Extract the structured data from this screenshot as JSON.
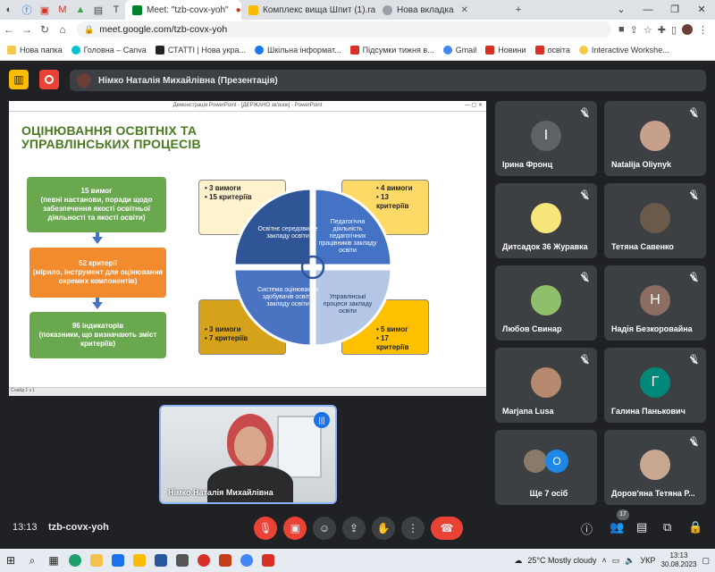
{
  "browser": {
    "tabs": [
      {
        "label": "Meet: \"tzb-covx-yoh\"",
        "active": true
      },
      {
        "label": "Комплекс вища Шпит (1).rar - G",
        "active": false
      },
      {
        "label": "Нова вкладка",
        "active": false
      }
    ],
    "url": "meet.google.com/tzb-covx-yoh",
    "bookmarks": [
      "Нова папка",
      "Головна – Canva",
      "СТАТТІ | Нова укра...",
      "Шкільна інформат...",
      "Підсумки тижня в...",
      "Gmail",
      "Новини",
      "освіта",
      "Interactive Workshe..."
    ]
  },
  "meet": {
    "presenting_label": "Німко Наталія Михайлівна (Презентація)",
    "time": "13:13",
    "code": "tzb-covx-yoh",
    "participants_badge": "17"
  },
  "slide": {
    "window_title": "Демонстрація PowerPoint - [ДЕРЖАНО зв'язок] - PowerPoint",
    "title_line1": "ОЦІНЮВАННЯ ОСВІТНІХ ТА",
    "title_line2": "УПРАВЛІНСЬКИХ ПРОЦЕСІВ",
    "green1_line1": "15 вимог",
    "green1_line2": "(певні настанови, поради щодо забезпечення якості освітньої діяльності та якості освіти)",
    "orange_line1": "52 критерії",
    "orange_line2": "(мірило, інструмент для оцінювання окремих компонентів)",
    "green2_line1": "96 індикаторів",
    "green2_line2": "(показники, що визначають зміст критеріїв)",
    "q1": "Освітнє середовище закладу освіти",
    "q2": "Педагогічна діяльність педагогічних працівників закладу освіти",
    "q3": "Система оцінювання здобувачів освіти закладу освіти",
    "q4": "Управлінські процеси закладу освіти",
    "box_tl": [
      "3 вимоги",
      "15 критеріїв"
    ],
    "box_tr": [
      "4 вимоги",
      "13 критеріїв"
    ],
    "box_bl": [
      "3 вимоги",
      "7 критеріїв"
    ],
    "box_br": [
      "5 вимог",
      "17 критеріїв"
    ],
    "status": "Слайд 1 з 1"
  },
  "participants": [
    {
      "name": "Ірина Фронц",
      "initial": "І",
      "color": "#5f6368"
    },
    {
      "name": "Natalija Oliynyk",
      "initial": "",
      "color": "#c7a08a"
    },
    {
      "name": "Дитсадок 36 Журавка",
      "initial": "",
      "color": "#f7e57a"
    },
    {
      "name": "Тетяна Савенко",
      "initial": "",
      "color": "#6b5a4a"
    },
    {
      "name": "Любов Свинар",
      "initial": "",
      "color": "#8fbf6a"
    },
    {
      "name": "Надія Безкоровайна",
      "initial": "Н",
      "color": "#8d6e63"
    },
    {
      "name": "Marjana Lusa",
      "initial": "",
      "color": "#b58a6e"
    },
    {
      "name": "Галина Панькович",
      "initial": "Г",
      "color": "#00897b"
    },
    {
      "name": "Ще 7 осіб",
      "initial": "О",
      "color": "#1e88e5"
    },
    {
      "name": "Доров'яна Тетяна Р...",
      "initial": "",
      "color": "#c9a890"
    }
  ],
  "self_name": "Німко Наталія Михайлівна",
  "taskbar": {
    "weather": "25°C  Mostly cloudy",
    "lang": "УКР",
    "time": "13:13",
    "date": "30.08.2023"
  },
  "colors": {
    "green": "#6aa84f",
    "orange": "#f28a2e",
    "blue": "#4472c4",
    "yellow": "#ffc000",
    "cream": "#fff2cc"
  }
}
